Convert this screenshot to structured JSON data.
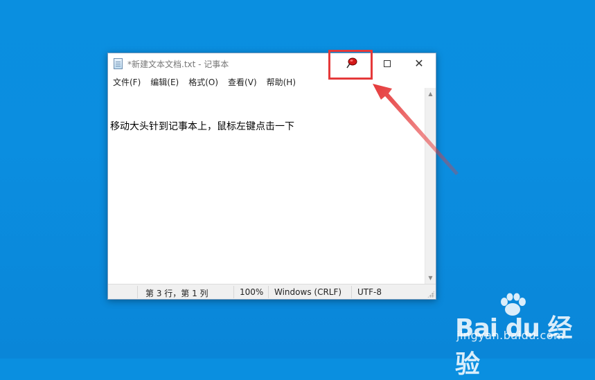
{
  "window": {
    "title": "*新建文本文档.txt - 记事本",
    "maximize_icon": "maximize-icon",
    "close_glyph": "✕",
    "pin_icon": "pushpin-icon"
  },
  "menu": [
    "文件(F)",
    "编辑(E)",
    "格式(O)",
    "查看(V)",
    "帮助(H)"
  ],
  "editor": {
    "content": "移动大头针到记事本上，鼠标左键点击一下"
  },
  "status": {
    "position": "第 3 行，第 1 列",
    "zoom": "100%",
    "line_ending": "Windows (CRLF)",
    "encoding": "UTF-8"
  },
  "annotation": {
    "color": "#e5393a"
  },
  "watermark": {
    "logo": "Bai du 经验",
    "url": "jingyan.baidu.com"
  }
}
